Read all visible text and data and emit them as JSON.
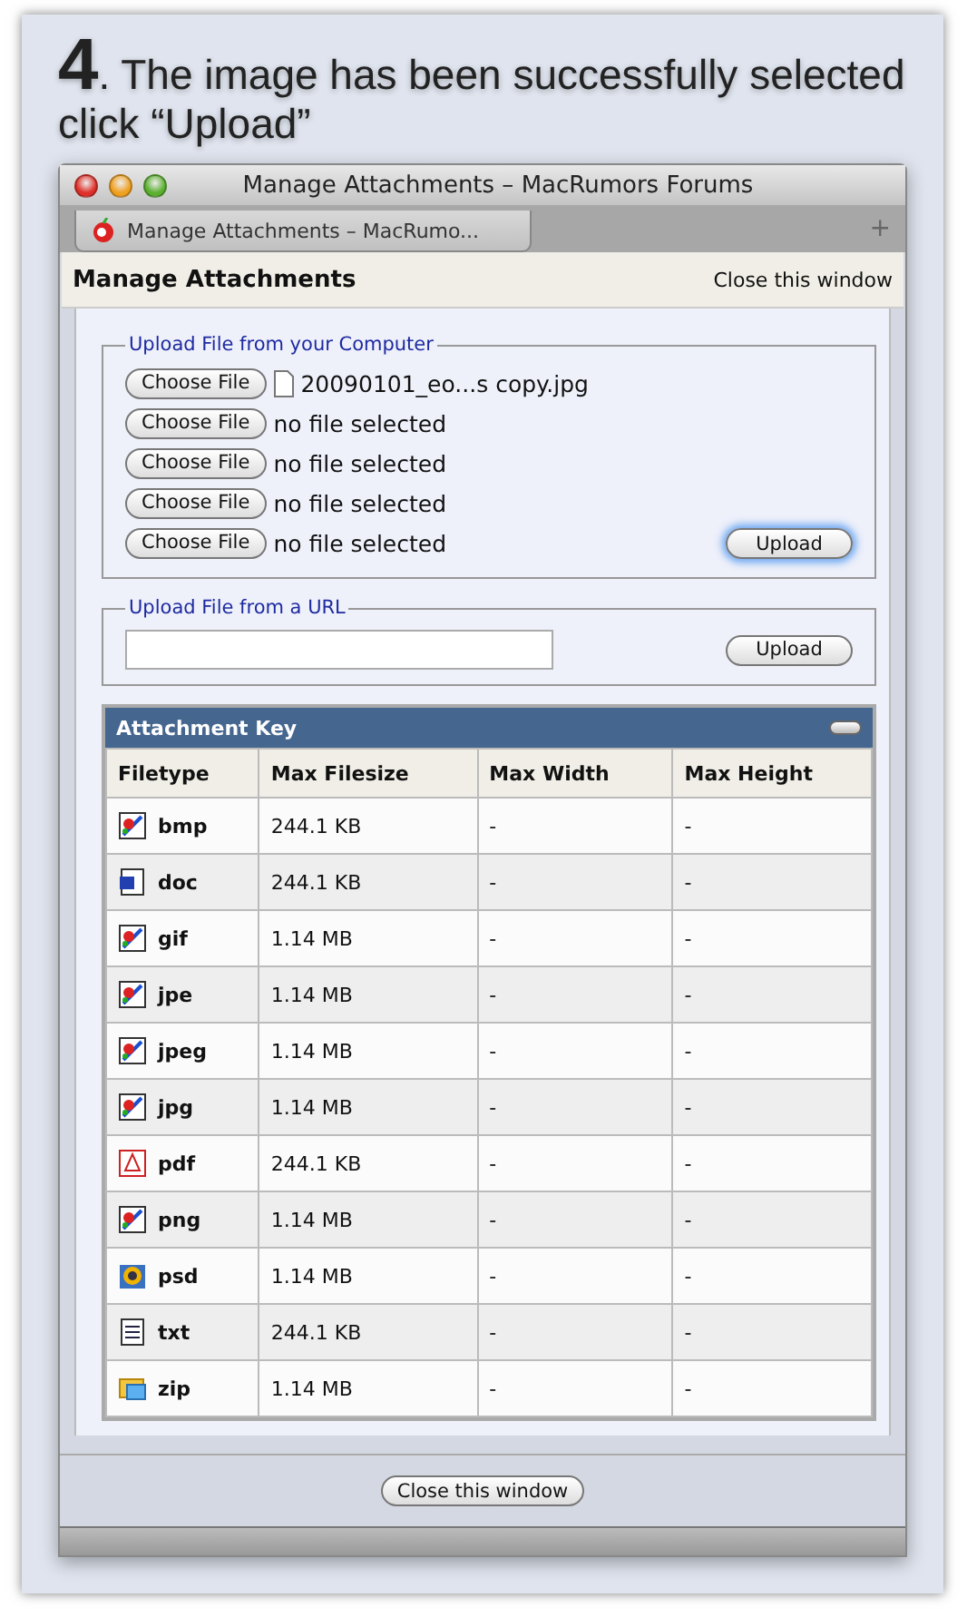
{
  "heading": {
    "number": "4",
    "lines": [
      ". The image has been successfully selected",
      "click “Upload”"
    ]
  },
  "window": {
    "title": "Manage Attachments – MacRumors Forums",
    "tab": {
      "label": "Manage Attachments – MacRumo...",
      "selected": true
    },
    "new_tab": "+"
  },
  "page": {
    "title": "Manage Attachments",
    "close_link": "Close this window"
  },
  "computer_upload": {
    "legend": "Upload File from your Computer",
    "files": [
      {
        "button": "Choose File",
        "status": "20090101_eo...s copy.jpg",
        "has_file": true
      },
      {
        "button": "Choose File",
        "status": "no file selected",
        "has_file": false
      },
      {
        "button": "Choose File",
        "status": "no file selected",
        "has_file": false
      },
      {
        "button": "Choose File",
        "status": "no file selected",
        "has_file": false
      },
      {
        "button": "Choose File",
        "status": "no file selected",
        "has_file": false
      }
    ],
    "upload_button": {
      "label": "Upload",
      "focused": true
    }
  },
  "url_upload": {
    "legend": "Upload File from a URL",
    "upload_button": {
      "label": "Upload",
      "focused": false
    }
  },
  "attachment_key": {
    "title": "Attachment Key",
    "expanded": true,
    "columns": [
      "Filetype",
      "Max Filesize",
      "Max Width",
      "Max Height"
    ],
    "rows": [
      {
        "kind": "image",
        "type": "bmp",
        "size": "244.1 KB",
        "width": "-",
        "height": "-"
      },
      {
        "kind": "word",
        "type": "doc",
        "size": "244.1 KB",
        "width": "-",
        "height": "-"
      },
      {
        "kind": "image",
        "type": "gif",
        "size": "1.14 MB",
        "width": "-",
        "height": "-"
      },
      {
        "kind": "image",
        "type": "jpe",
        "size": "1.14 MB",
        "width": "-",
        "height": "-"
      },
      {
        "kind": "image",
        "type": "jpeg",
        "size": "1.14 MB",
        "width": "-",
        "height": "-"
      },
      {
        "kind": "image",
        "type": "jpg",
        "size": "1.14 MB",
        "width": "-",
        "height": "-"
      },
      {
        "kind": "acrobat",
        "type": "pdf",
        "size": "244.1 KB",
        "width": "-",
        "height": "-"
      },
      {
        "kind": "image",
        "type": "png",
        "size": "1.14 MB",
        "width": "-",
        "height": "-"
      },
      {
        "kind": "photoshop",
        "type": "psd",
        "size": "1.14 MB",
        "width": "-",
        "height": "-"
      },
      {
        "kind": "notepad",
        "type": "txt",
        "size": "244.1 KB",
        "width": "-",
        "height": "-"
      },
      {
        "kind": "archive",
        "type": "zip",
        "size": "1.14 MB",
        "width": "-",
        "height": "-"
      }
    ]
  },
  "footer_button": "Close this window"
}
